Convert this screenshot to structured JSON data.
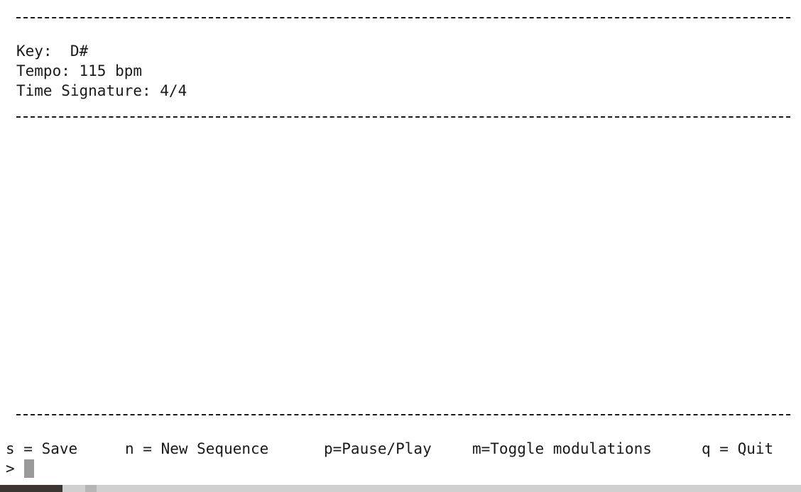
{
  "info": {
    "key_line": "Key:  D#",
    "tempo_line": "Tempo: 115 bpm",
    "time_signature_line": "Time Signature: 4/4"
  },
  "commands": [
    {
      "label": "s = Save"
    },
    {
      "label": "n = New Sequence"
    },
    {
      "label": "p=Pause/Play"
    },
    {
      "label": "m=Toggle modulations"
    },
    {
      "label": "q = Quit"
    }
  ],
  "prompt": {
    "symbol": ">"
  }
}
